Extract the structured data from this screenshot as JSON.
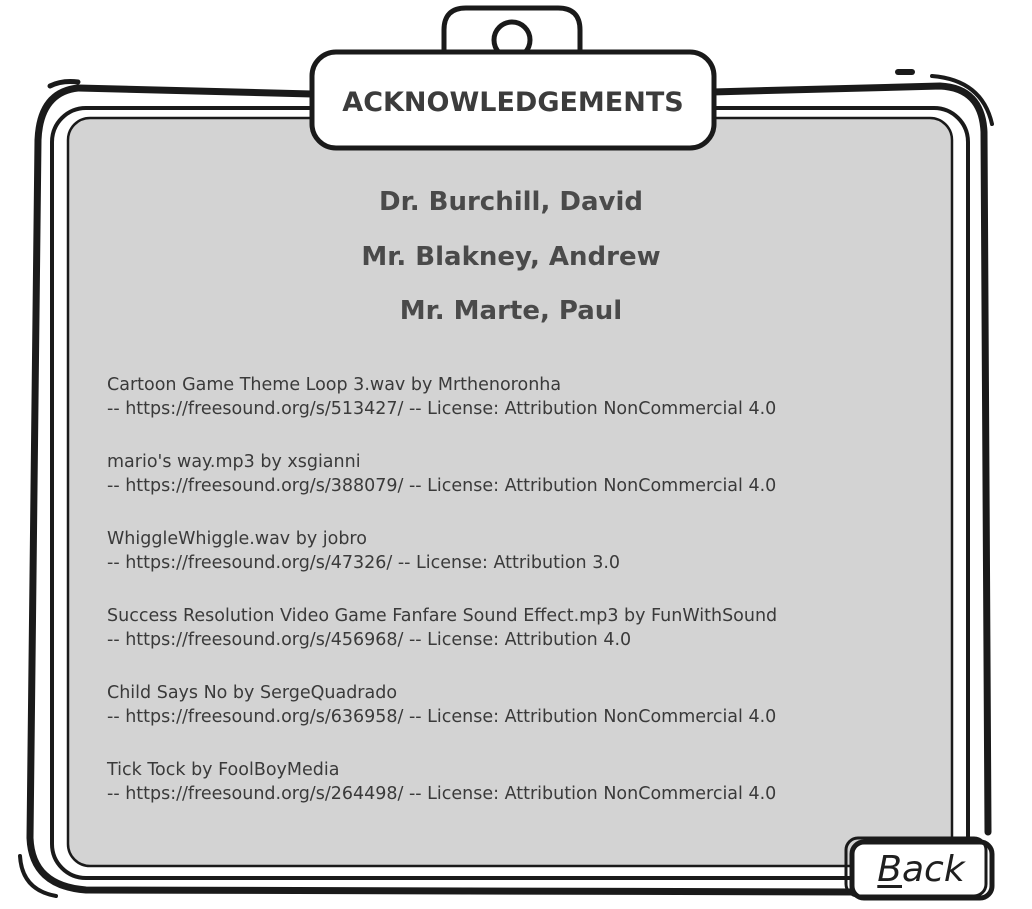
{
  "header": {
    "title": "ACKNOWLEDGEMENTS"
  },
  "names": [
    "Dr. Burchill, David",
    "Mr. Blakney, Andrew",
    "Mr. Marte, Paul"
  ],
  "credits": [
    {
      "title": "Cartoon Game Theme Loop 3.wav by Mrthenoronha",
      "detail": "-- https://freesound.org/s/513427/ -- License: Attribution NonCommercial 4.0"
    },
    {
      "title": "mario's way.mp3 by xsgianni",
      "detail": "-- https://freesound.org/s/388079/ -- License: Attribution NonCommercial 4.0"
    },
    {
      "title": "WhiggleWhiggle.wav by jobro",
      "detail": "-- https://freesound.org/s/47326/ -- License: Attribution 3.0"
    },
    {
      "title": "Success Resolution Video Game Fanfare Sound Effect.mp3 by FunWithSound",
      "detail": "-- https://freesound.org/s/456968/ -- License: Attribution 4.0"
    },
    {
      "title": "Child Says No by SergeQuadrado",
      "detail": "-- https://freesound.org/s/636958/ -- License: Attribution NonCommercial 4.0"
    },
    {
      "title": "Tick Tock by FoolBoyMedia",
      "detail": "-- https://freesound.org/s/264498/ -- License: Attribution NonCommercial 4.0"
    }
  ],
  "back_button": {
    "first_letter": "B",
    "rest": "ack"
  },
  "colors": {
    "panel": "#d3d3d3",
    "ink": "#1a1a1a",
    "text": "#3e3e3e"
  }
}
